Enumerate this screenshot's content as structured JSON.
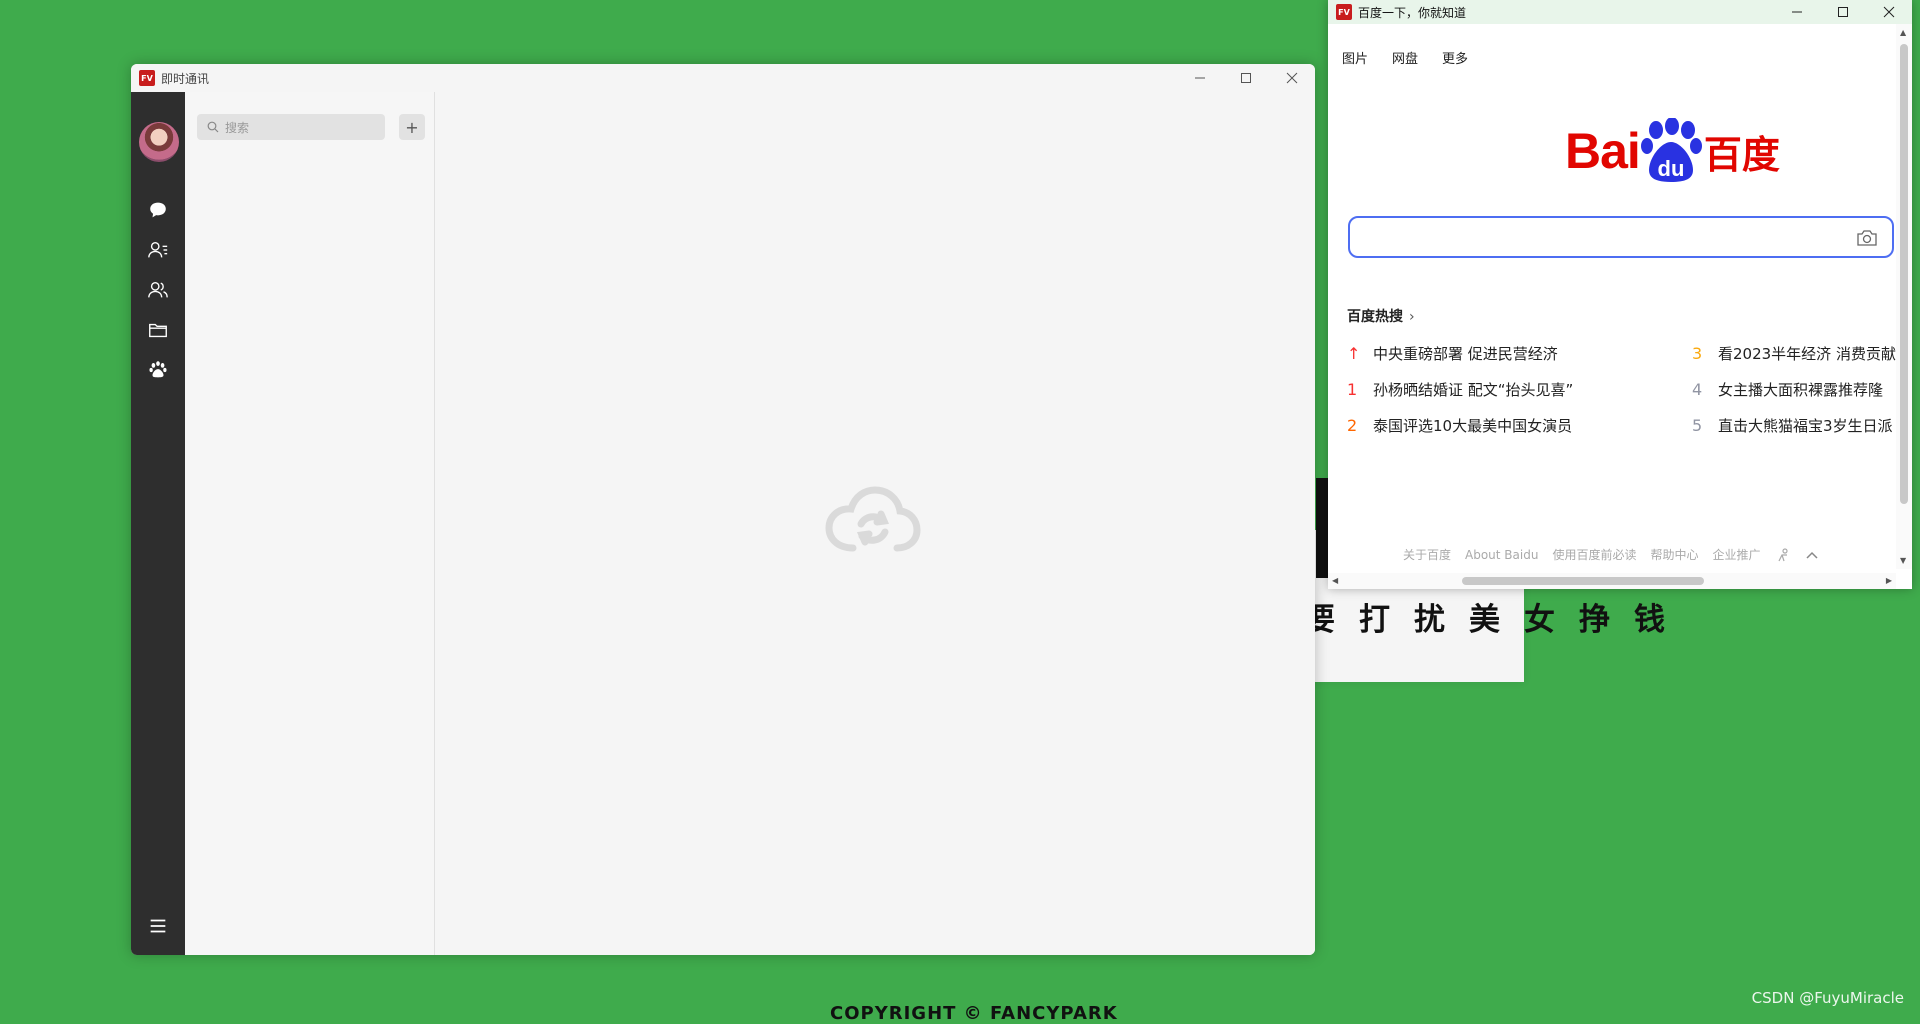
{
  "background": {
    "slogan": "要打扰美女挣钱",
    "copyright": "COPYRIGHT © FANCYPARK",
    "watermark": "CSDN @FuyuMiracle",
    "color": "#3fab4c"
  },
  "im_window": {
    "app_badge": "FV",
    "title": "即时通讯",
    "search_placeholder": "搜索",
    "add_label": "+",
    "sidebar_icons": [
      "chat-bubble-icon",
      "contacts-icon",
      "group-icon",
      "folder-icon",
      "paw-icon"
    ],
    "menu_icon": "hamburger-menu-icon",
    "empty_logo_icon": "cloud-sync-icon"
  },
  "baidu_window": {
    "app_badge": "FV",
    "title": "百度一下，你就知道",
    "nav": [
      "图片",
      "网盘",
      "更多"
    ],
    "logo": {
      "bai": "Bai",
      "du": "du",
      "hanzi": "百度",
      "brand_red": "#e10601",
      "brand_blue": "#2932e1"
    },
    "hot_title": "百度热搜",
    "hot_left": [
      {
        "rank": "↑",
        "text": "中央重磅部署 促进民营经济",
        "color": "#f73131"
      },
      {
        "rank": "1",
        "text": "孙杨晒结婚证 配文“抬头见喜”",
        "color": "#f73131"
      },
      {
        "rank": "2",
        "text": "泰国评选10大最美中国女演员",
        "color": "#ff6600"
      }
    ],
    "hot_right": [
      {
        "rank": "3",
        "text": "看2023半年经济 消费贡献",
        "color": "#faa90e"
      },
      {
        "rank": "4",
        "text": "女主播大面积裸露推荐隆",
        "color": "#9195a3"
      },
      {
        "rank": "5",
        "text": "直击大熊猫福宝3岁生日派",
        "color": "#9195a3"
      }
    ],
    "footer": [
      "关于百度",
      "About Baidu",
      "使用百度前必读",
      "帮助中心",
      "企业推广"
    ]
  }
}
